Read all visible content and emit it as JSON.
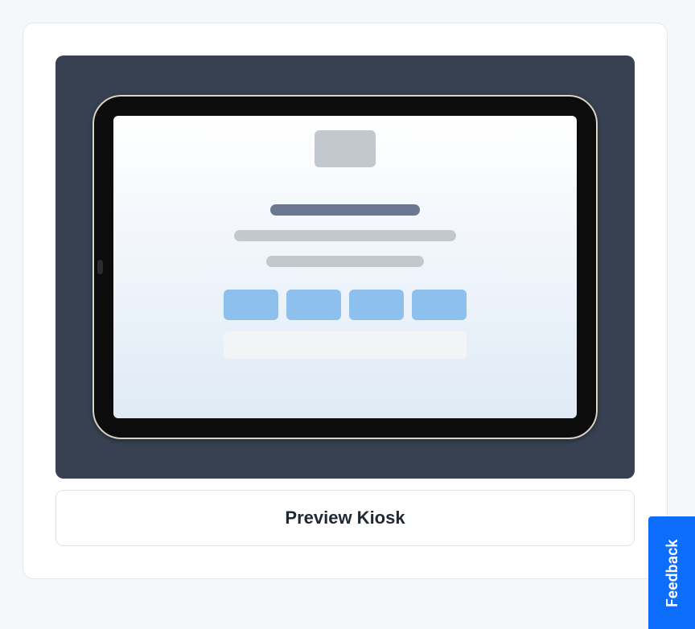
{
  "preview": {
    "button_label": "Preview Kiosk"
  },
  "feedback": {
    "tab_label": "Feedback"
  }
}
